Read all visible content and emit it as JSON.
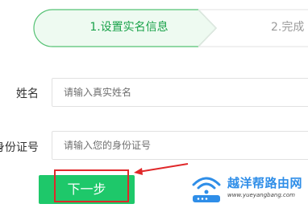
{
  "steps": {
    "active_label": "1.设置实名信息",
    "next_label": "2.完成"
  },
  "form": {
    "name_label": "姓名",
    "name_placeholder": "请输入真实姓名",
    "id_label": "身份证号",
    "id_placeholder": "请输入您的身份证号",
    "next_button": "下一步"
  },
  "watermark": {
    "title": "越洋帮路由网",
    "url": "www.yueyangbang.com"
  },
  "colors": {
    "accent": "#1ec86a",
    "step_active_text": "#1aa24a",
    "annotation": "#e0282a",
    "watermark": "#2f8ee8"
  }
}
